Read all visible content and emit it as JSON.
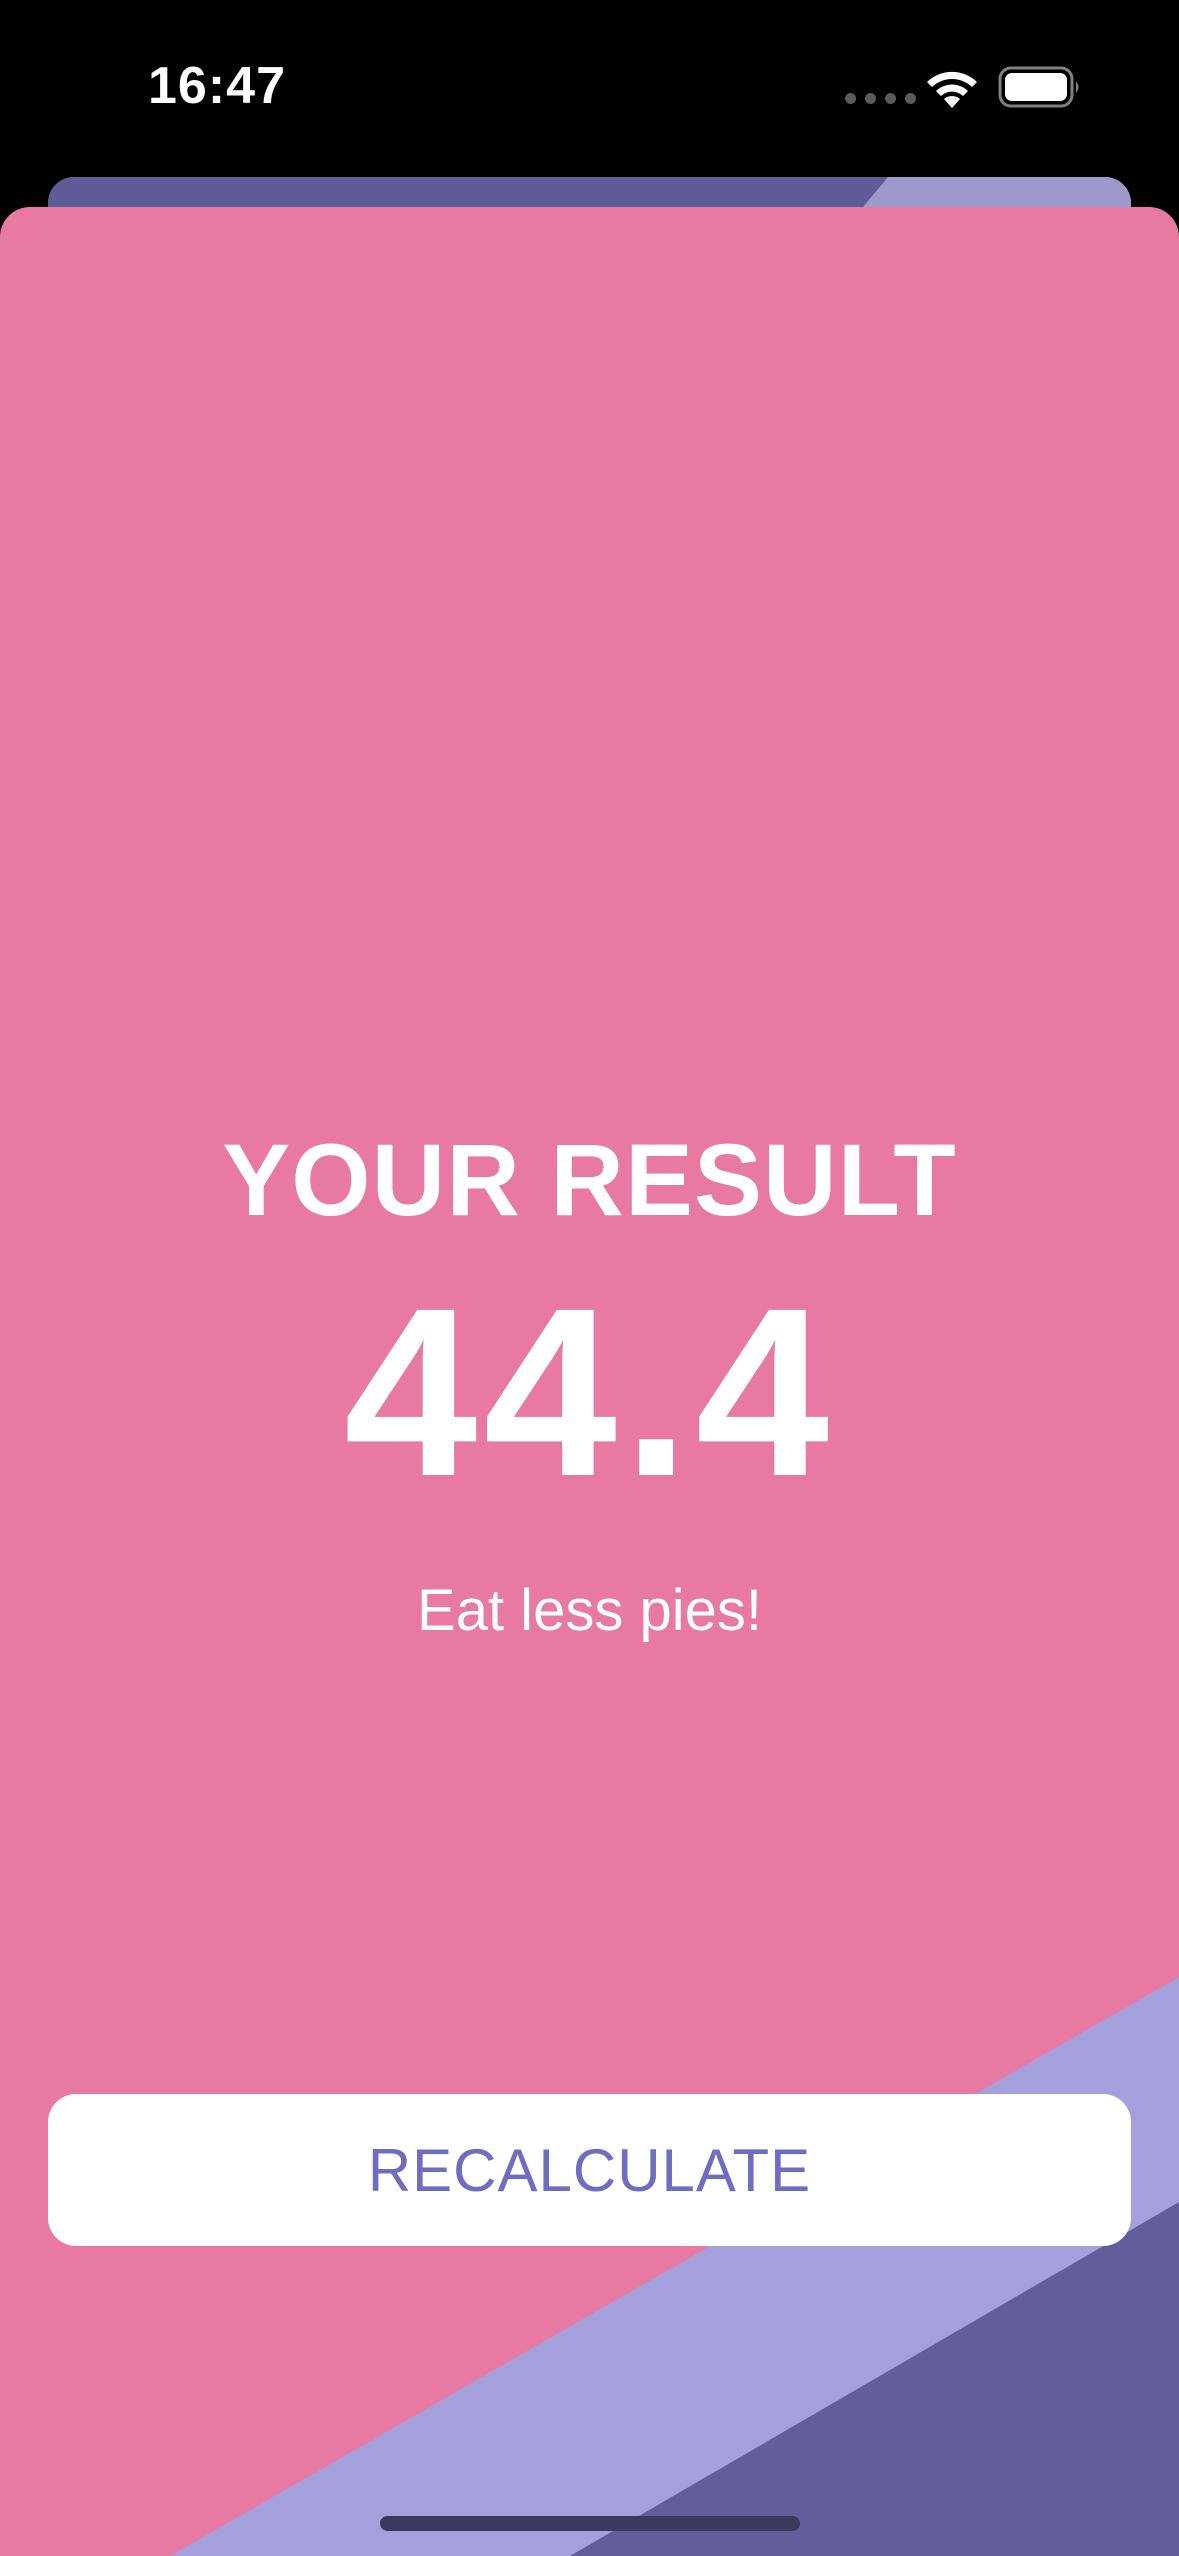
{
  "status_bar": {
    "time": "16:47",
    "icons": [
      "cellular-dots-icon",
      "wifi-icon",
      "battery-icon"
    ]
  },
  "result": {
    "title": "YOUR RESULT",
    "value": "44.4",
    "advice": "Eat less pies!"
  },
  "actions": {
    "recalculate_label": "RECALCULATE"
  },
  "colors": {
    "background": "#000000",
    "card": "#e879a2",
    "accent_light_purple": "#a3a0dc",
    "accent_dark_purple": "#625e9b",
    "button_text": "#6e6dc4",
    "text": "#ffffff"
  }
}
